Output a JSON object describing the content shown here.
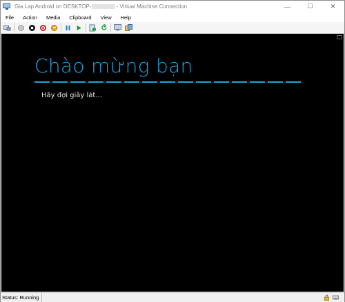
{
  "window": {
    "title_prefix": "Gia Lap Android on DESKTOP-",
    "title_suffix": "- Virtual Machine Connection",
    "minimize_glyph": "—",
    "maximize_glyph": "☐",
    "close_glyph": "✕"
  },
  "menu": {
    "items": [
      "File",
      "Action",
      "Media",
      "Clipboard",
      "View",
      "Help"
    ]
  },
  "toolbar": {
    "buttons": [
      "ctrl-alt-del-icon",
      "start-icon",
      "turn-off-icon",
      "shut-down-icon",
      "save-icon",
      "pause-icon",
      "resume-icon",
      "checkpoint-icon",
      "revert-icon",
      "enhanced-session-icon",
      "share-icon"
    ]
  },
  "vm_screen": {
    "welcome_text": "Chào mừng bạn",
    "wait_text": "Hãy đợi giây lát...",
    "accent_color": "#1fa3e2",
    "background_color": "#000000"
  },
  "status": {
    "text": "Status: Running"
  }
}
